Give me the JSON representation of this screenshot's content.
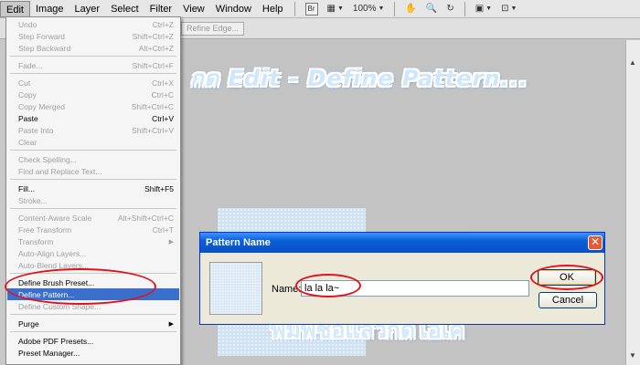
{
  "menubar": {
    "items": [
      "Edit",
      "Image",
      "Layer",
      "Select",
      "Filter",
      "View",
      "Window",
      "Help"
    ],
    "br_label": "Br",
    "zoom": "100%"
  },
  "options_bar": {
    "refine_edge": "Refine Edge..."
  },
  "edit_menu": {
    "items": [
      {
        "label": "Undo",
        "shortcut": "Ctrl+Z"
      },
      {
        "label": "Step Forward",
        "shortcut": "Shift+Ctrl+Z"
      },
      {
        "label": "Step Backward",
        "shortcut": "Alt+Ctrl+Z"
      },
      {
        "label": "Fade...",
        "shortcut": "Shift+Ctrl+F"
      },
      {
        "label": "Cut",
        "shortcut": "Ctrl+X"
      },
      {
        "label": "Copy",
        "shortcut": "Ctrl+C"
      },
      {
        "label": "Copy Merged",
        "shortcut": "Shift+Ctrl+C"
      },
      {
        "label": "Paste",
        "shortcut": "Ctrl+V"
      },
      {
        "label": "Paste Into",
        "shortcut": "Shift+Ctrl+V"
      },
      {
        "label": "Clear",
        "shortcut": ""
      },
      {
        "label": "Check Spelling...",
        "shortcut": ""
      },
      {
        "label": "Find and Replace Text...",
        "shortcut": ""
      },
      {
        "label": "Fill...",
        "shortcut": "Shift+F5"
      },
      {
        "label": "Stroke...",
        "shortcut": ""
      },
      {
        "label": "Content-Aware Scale",
        "shortcut": "Alt+Shift+Ctrl+C"
      },
      {
        "label": "Free Transform",
        "shortcut": "Ctrl+T"
      },
      {
        "label": "Transform",
        "shortcut": ""
      },
      {
        "label": "Auto-Align Layers...",
        "shortcut": ""
      },
      {
        "label": "Auto-Blend Layers...",
        "shortcut": ""
      },
      {
        "label": "Define Brush Preset...",
        "shortcut": ""
      },
      {
        "label": "Define Pattern...",
        "shortcut": ""
      },
      {
        "label": "Define Custom Shape...",
        "shortcut": ""
      },
      {
        "label": "Purge",
        "shortcut": ""
      },
      {
        "label": "Adobe PDF Presets...",
        "shortcut": ""
      },
      {
        "label": "Preset Manager...",
        "shortcut": ""
      }
    ]
  },
  "caption_top": "กด Edit - Define Pattern...",
  "caption_bottom": "พิมพ์ชื่อแล้วกดโอเค",
  "dialog": {
    "title": "Pattern Name",
    "name_label": "Name:",
    "name_value": "la la la~",
    "ok_label": "OK",
    "cancel_label": "Cancel"
  },
  "colors": {
    "highlight": "#3a6fcc",
    "annotation_red": "#e0141e",
    "dialog_title": "#0a5fd8"
  }
}
